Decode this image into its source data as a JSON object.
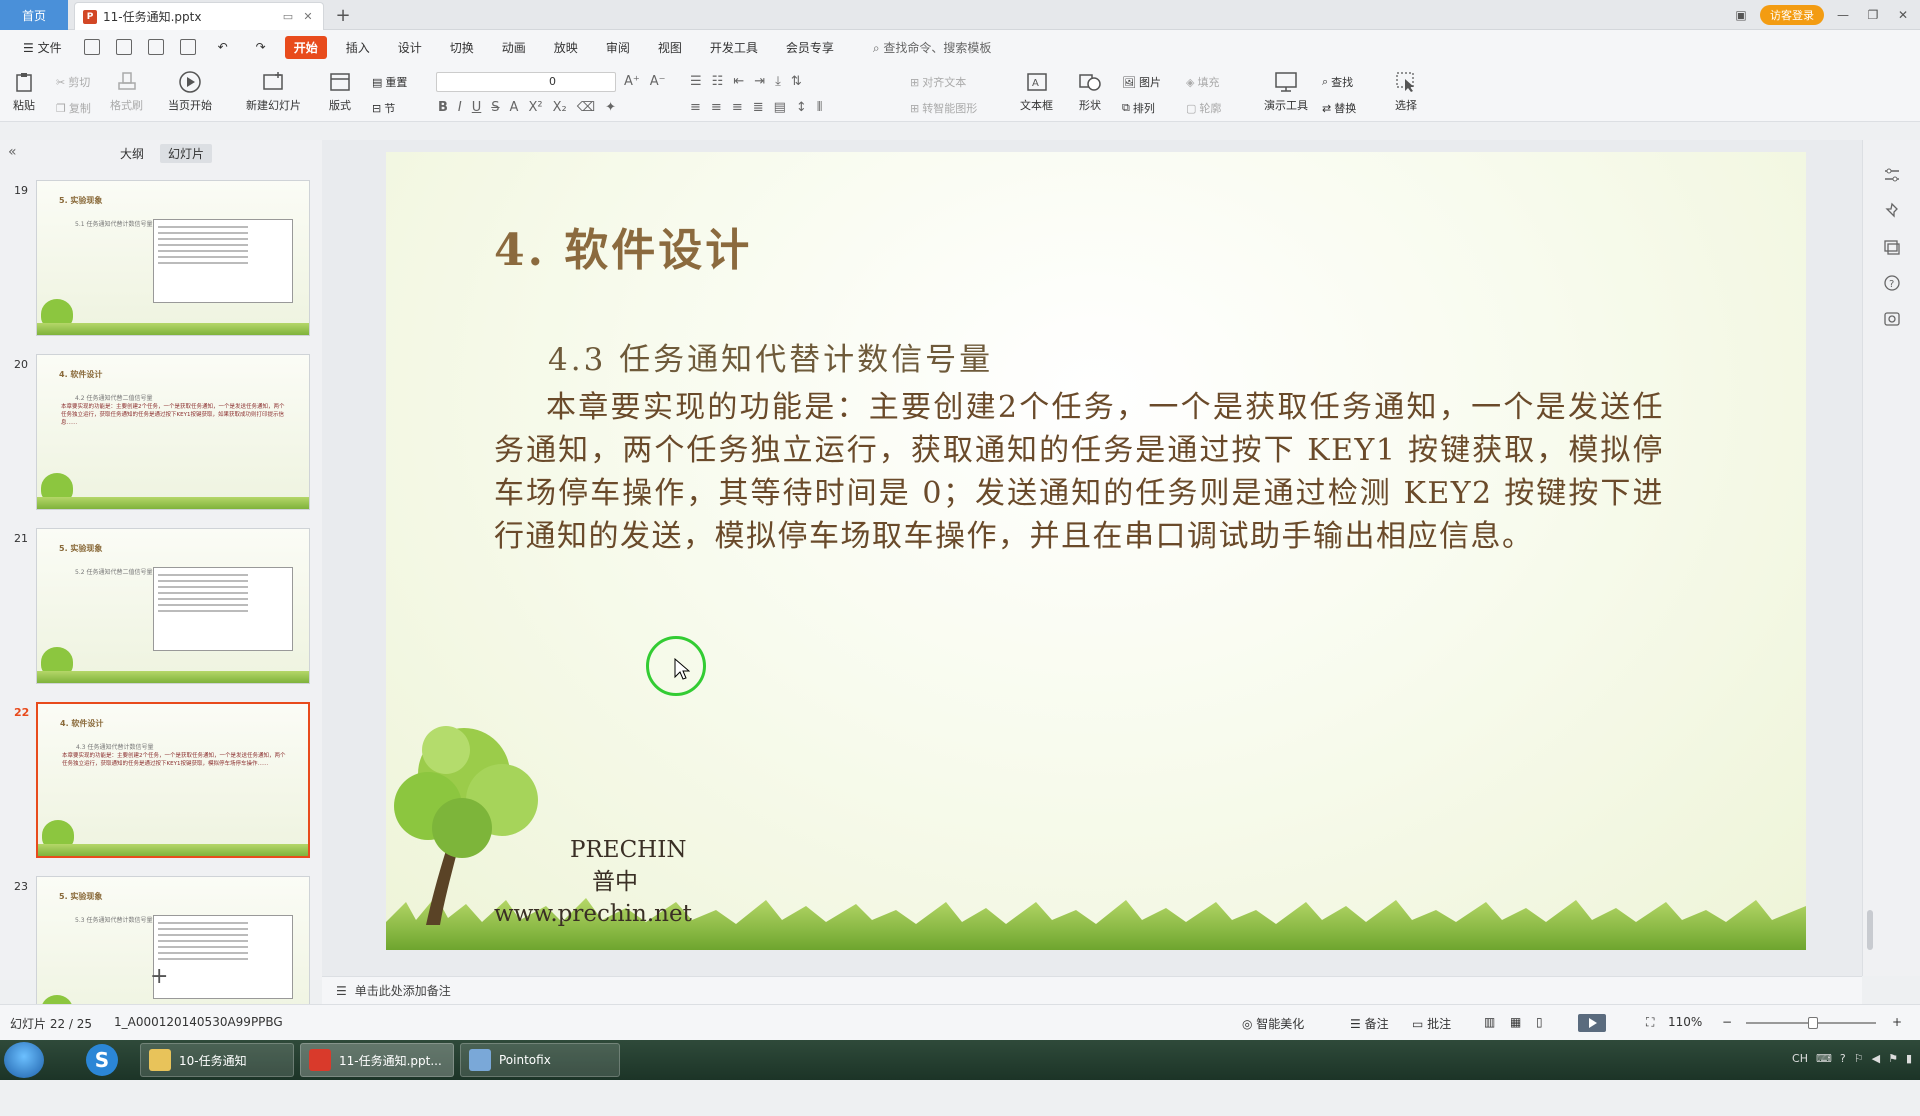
{
  "window": {
    "home_tab": "首页",
    "doc_tab": "11-任务通知.pptx",
    "pptx_glyph": "P",
    "new_tab": "+",
    "guest_button": "访客登录",
    "minimize": "—",
    "restore": "❐",
    "close": "✕"
  },
  "menu": {
    "file": "文件",
    "items": [
      "开始",
      "插入",
      "设计",
      "切换",
      "动画",
      "放映",
      "审阅",
      "视图",
      "开发工具",
      "会员专享"
    ],
    "search": "查找命令、搜索模板"
  },
  "ribbon": {
    "paste": "粘贴",
    "cut": "剪切",
    "copy": "复制",
    "format_painter": "格式刷",
    "play_from_current": "当页开始",
    "new_slide": "新建幻灯片",
    "layout": "版式",
    "reset": "重置",
    "section": "节",
    "font_size": "0",
    "align_text": "对齐文本",
    "to_smartart": "转智能图形",
    "textbox": "文本框",
    "shape": "形状",
    "picture": "图片",
    "fill": "填充",
    "arrange": "排列",
    "outline": "轮廓",
    "presentation_tools": "演示工具",
    "find": "查找",
    "replace": "替换",
    "select": "选择"
  },
  "left_panel": {
    "collapse": "«",
    "tab_outline": "大纲",
    "tab_slides": "幻灯片",
    "add_slide": "+",
    "thumbnails": [
      {
        "num": "19",
        "title": "5. 实验现象",
        "sub": "5.1 任务通知代替计数信号量",
        "para": "",
        "has_shot": true,
        "active": false
      },
      {
        "num": "20",
        "title": "4. 软件设计",
        "sub": "4.2 任务通知代替二值信号量",
        "para": "本章要实现的功能是：主要创建2个任务，一个是获取任务通知，一个是发送任务通知，两个任务独立运行，获取任务通知的任务是通过按下KEY1按键获取，如果获取成功则打印提示信息……",
        "has_shot": false,
        "active": false
      },
      {
        "num": "21",
        "title": "5. 实验现象",
        "sub": "5.2 任务通知代替二值信号量",
        "para": "",
        "has_shot": true,
        "active": false
      },
      {
        "num": "22",
        "title": "4. 软件设计",
        "sub": "4.3 任务通知代替计数信号量",
        "para": "本章要实现的功能是：主要创建2个任务，一个是获取任务通知，一个是发送任务通知，两个任务独立运行，获取通知的任务是通过按下KEY1按键获取，模拟停车场停车操作……",
        "has_shot": false,
        "active": true
      },
      {
        "num": "23",
        "title": "5. 实验现象",
        "sub": "5.3 任务通知代替计数信号量",
        "para": "",
        "has_shot": true,
        "active": false
      }
    ]
  },
  "slide": {
    "title": "4. 软件设计",
    "subtitle": "4.3  任务通知代替计数信号量",
    "body": "本章要实现的功能是：主要创建2个任务，一个是获取任务通知，一个是发送任务通知，两个任务独立运行，获取通知的任务是通过按下 KEY1 按键获取，模拟停车场停车操作，其等待时间是 0；发送通知的任务则是通过检测 KEY2 按键按下进行通知的发送，模拟停车场取车操作，并且在串口调试助手输出相应信息。",
    "brand_en": "PRECHIN",
    "brand_cn": "普中",
    "brand_url": "www.prechin.net"
  },
  "notes": {
    "placeholder": "单击此处添加备注"
  },
  "status": {
    "slide_counter": "幻灯片 22 / 25",
    "theme": "1_A000120140530A99PPBG",
    "smart_beautify": "智能美化",
    "notes_btn": "备注",
    "comments_btn": "批注",
    "zoom": "110%",
    "zoom_out": "−",
    "zoom_in": "+"
  },
  "taskbar": {
    "items": [
      "10-任务通知",
      "11-任务通知.ppt...",
      "Pointofix"
    ],
    "tray_lang": "CH"
  },
  "colors": {
    "accent": "#e84b1c",
    "title_brown": "#8b6a3e",
    "body_brown": "#6a4a2a",
    "ring_green": "#33cc33"
  }
}
